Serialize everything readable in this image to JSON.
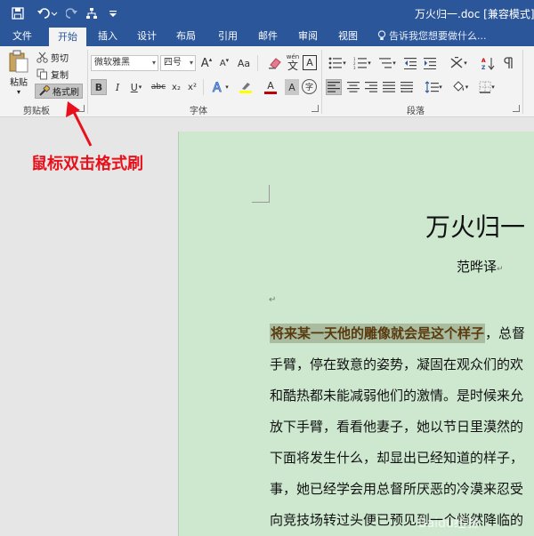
{
  "window": {
    "title": "万火归一.doc [兼容模式] - W"
  },
  "quick_access": {
    "icons": [
      "save-icon",
      "undo-icon",
      "redo-icon",
      "touch-mode-icon",
      "customize-icon"
    ]
  },
  "tabs": [
    {
      "label": "文件",
      "active": false
    },
    {
      "label": "开始",
      "active": true
    },
    {
      "label": "插入",
      "active": false
    },
    {
      "label": "设计",
      "active": false
    },
    {
      "label": "布局",
      "active": false
    },
    {
      "label": "引用",
      "active": false
    },
    {
      "label": "邮件",
      "active": false
    },
    {
      "label": "审阅",
      "active": false
    },
    {
      "label": "视图",
      "active": false
    }
  ],
  "tell_me": {
    "placeholder": "告诉我您想要做什么..."
  },
  "clipboard": {
    "paste_label": "粘贴",
    "cut_label": "剪切",
    "copy_label": "复制",
    "format_painter_label": "格式刷",
    "group_label": "剪贴板"
  },
  "font": {
    "font_name": "微软雅黑",
    "font_size": "四号",
    "group_label": "字体",
    "bold": "B",
    "italic": "I",
    "underline": "U",
    "strikethrough": "abc",
    "subscript": "x₂",
    "superscript": "x²",
    "grow": "A",
    "shrink": "A",
    "change_case": "Aa",
    "phonetic": "wén",
    "char_border": "A",
    "char_shading": "A",
    "font_color": "A",
    "enclose": "字",
    "font_color_hex": "#c00000",
    "highlight_color_hex": "#ffff00"
  },
  "paragraph": {
    "group_label": "段落"
  },
  "annotation": {
    "text": "鼠标双击格式刷",
    "color": "#e8101a"
  },
  "document": {
    "title": "万火归一",
    "author": "范晔译",
    "para_mark": "↵",
    "highlighted": "将来某一天他的雕像就会是这个样子",
    "lines": [
      "，总督",
      "手臂，停在致意的姿势，凝固在观众们的欢",
      "和酷热都未能减弱他们的激情。是时候来允",
      "放下手臂，看看他妻子，她以节日里漠然的",
      "下面将发生什么，却显出已经知道的样子，",
      "事，她已经学会用总督所厌恶的冷漠来忍受",
      "向竞技场转过头便已预见到一个悄然降临的"
    ],
    "page_color": "#cde8cf",
    "highlight_color": "#a9bc9f"
  },
  "watermark": {
    "text": "Baidu经验"
  }
}
